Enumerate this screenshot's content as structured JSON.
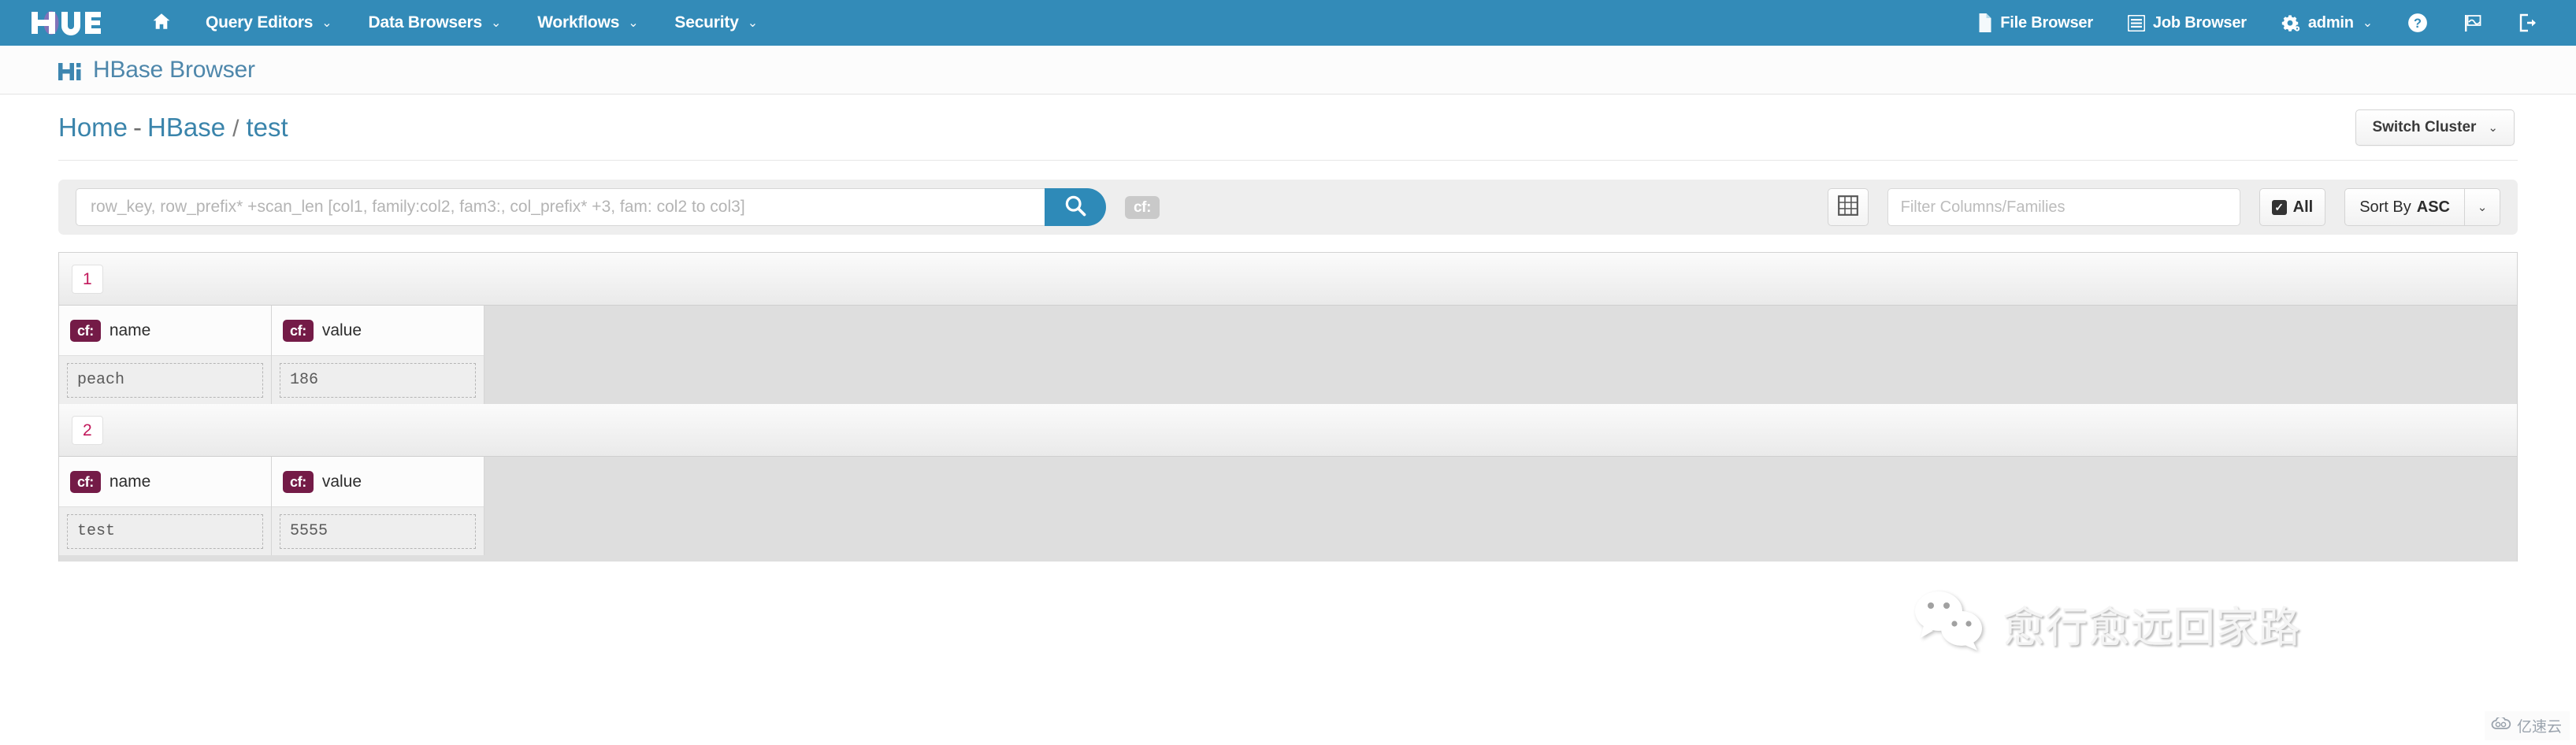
{
  "navbar": {
    "logo_text": "HUE",
    "brand_color": "#338bb8",
    "home_icon": "home-icon",
    "left_items": [
      {
        "label": "Query Editors",
        "caret": "⌄"
      },
      {
        "label": "Data Browsers",
        "caret": "⌄"
      },
      {
        "label": "Workflows",
        "caret": "⌄"
      },
      {
        "label": "Security",
        "caret": "⌄"
      }
    ],
    "right_items": [
      {
        "label": "File Browser",
        "icon": "file-icon"
      },
      {
        "label": "Job Browser",
        "icon": "list-icon"
      },
      {
        "label": "admin",
        "icon": "gear-icon",
        "caret": "⌄"
      }
    ],
    "icon_buttons": [
      {
        "name": "help-icon"
      },
      {
        "name": "flag-icon"
      },
      {
        "name": "sign-out-icon"
      }
    ]
  },
  "page": {
    "title": "HBase Browser",
    "title_color": "#4e87ab",
    "logo_icon": "hbase-logo-icon"
  },
  "breadcrumb": {
    "home": "Home",
    "dash": "-",
    "cluster": "HBase",
    "separator": "/",
    "table": "test"
  },
  "actions": {
    "switch_cluster_label": "Switch Cluster",
    "switch_cluster_caret": "⌄"
  },
  "toolbar": {
    "search_placeholder": "row_key, row_prefix* +scan_len [col1, family:col2, fam3:, col_prefix* +3, fam: col2 to col3]",
    "search_value": "",
    "search_icon": "search-icon",
    "cf_toggle_label": "cf:",
    "grid_icon": "grid-icon",
    "filter_placeholder": "Filter Columns/Families",
    "filter_value": "",
    "all_label": "All",
    "all_checked": true,
    "checkmark": "✓",
    "sort_label": "Sort By",
    "sort_direction": "ASC",
    "sort_caret": "⌄"
  },
  "results": {
    "column_family_badge": "cf:",
    "rows": [
      {
        "row_key": "1",
        "cells": [
          {
            "family": "cf:",
            "column": "name",
            "value": "peach"
          },
          {
            "family": "cf:",
            "column": "value",
            "value": "186"
          }
        ]
      },
      {
        "row_key": "2",
        "cells": [
          {
            "family": "cf:",
            "column": "name",
            "value": "test"
          },
          {
            "family": "cf:",
            "column": "value",
            "value": "5555"
          }
        ]
      }
    ]
  },
  "watermark": {
    "icon": "wechat-icon",
    "text": "愈行愈远回家路"
  },
  "corner_badge": {
    "icon": "cloud-icon",
    "text": "亿速云"
  }
}
